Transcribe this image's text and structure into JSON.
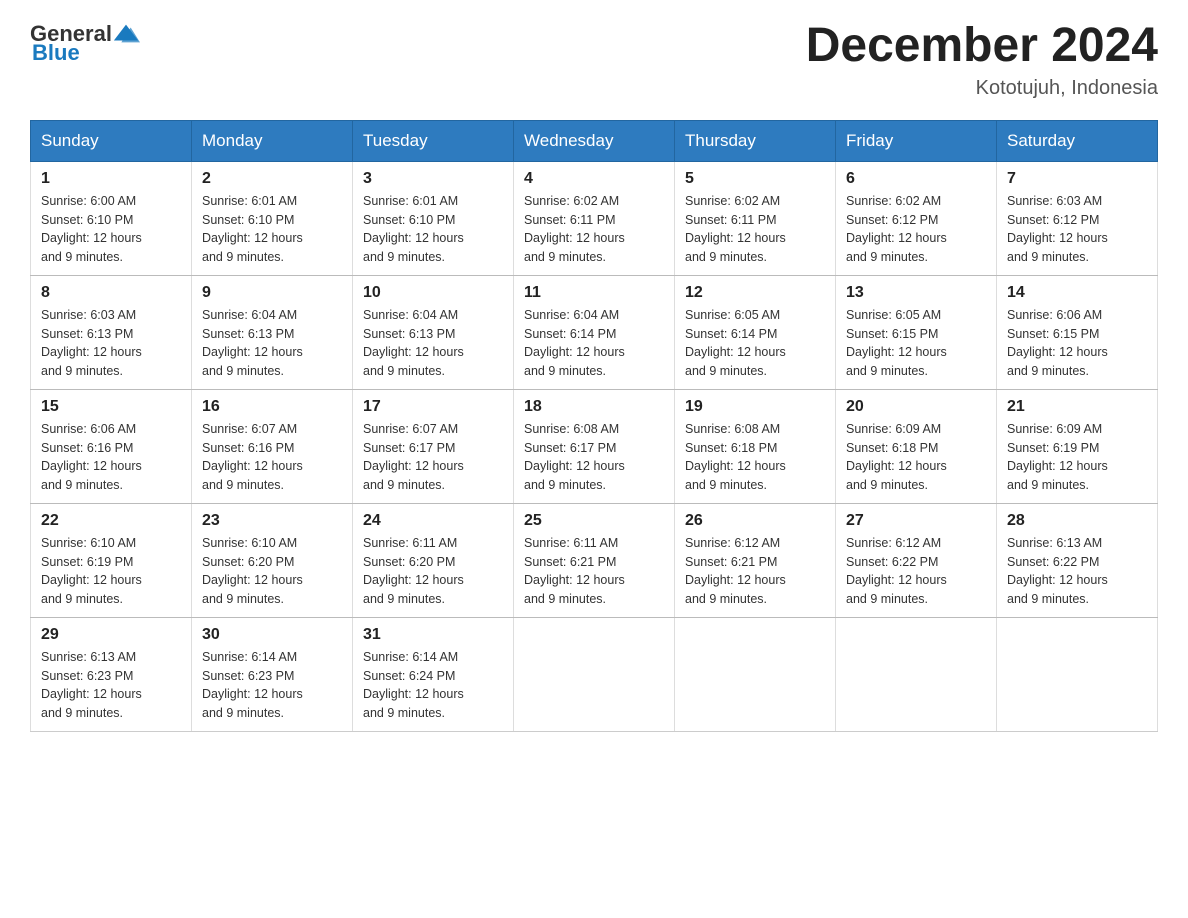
{
  "header": {
    "logo": {
      "general": "General",
      "blue": "Blue"
    },
    "title": "December 2024",
    "location": "Kototujuh, Indonesia"
  },
  "days_of_week": [
    "Sunday",
    "Monday",
    "Tuesday",
    "Wednesday",
    "Thursday",
    "Friday",
    "Saturday"
  ],
  "weeks": [
    [
      {
        "day": "1",
        "sunrise": "6:00 AM",
        "sunset": "6:10 PM",
        "daylight": "12 hours and 9 minutes."
      },
      {
        "day": "2",
        "sunrise": "6:01 AM",
        "sunset": "6:10 PM",
        "daylight": "12 hours and 9 minutes."
      },
      {
        "day": "3",
        "sunrise": "6:01 AM",
        "sunset": "6:10 PM",
        "daylight": "12 hours and 9 minutes."
      },
      {
        "day": "4",
        "sunrise": "6:02 AM",
        "sunset": "6:11 PM",
        "daylight": "12 hours and 9 minutes."
      },
      {
        "day": "5",
        "sunrise": "6:02 AM",
        "sunset": "6:11 PM",
        "daylight": "12 hours and 9 minutes."
      },
      {
        "day": "6",
        "sunrise": "6:02 AM",
        "sunset": "6:12 PM",
        "daylight": "12 hours and 9 minutes."
      },
      {
        "day": "7",
        "sunrise": "6:03 AM",
        "sunset": "6:12 PM",
        "daylight": "12 hours and 9 minutes."
      }
    ],
    [
      {
        "day": "8",
        "sunrise": "6:03 AM",
        "sunset": "6:13 PM",
        "daylight": "12 hours and 9 minutes."
      },
      {
        "day": "9",
        "sunrise": "6:04 AM",
        "sunset": "6:13 PM",
        "daylight": "12 hours and 9 minutes."
      },
      {
        "day": "10",
        "sunrise": "6:04 AM",
        "sunset": "6:13 PM",
        "daylight": "12 hours and 9 minutes."
      },
      {
        "day": "11",
        "sunrise": "6:04 AM",
        "sunset": "6:14 PM",
        "daylight": "12 hours and 9 minutes."
      },
      {
        "day": "12",
        "sunrise": "6:05 AM",
        "sunset": "6:14 PM",
        "daylight": "12 hours and 9 minutes."
      },
      {
        "day": "13",
        "sunrise": "6:05 AM",
        "sunset": "6:15 PM",
        "daylight": "12 hours and 9 minutes."
      },
      {
        "day": "14",
        "sunrise": "6:06 AM",
        "sunset": "6:15 PM",
        "daylight": "12 hours and 9 minutes."
      }
    ],
    [
      {
        "day": "15",
        "sunrise": "6:06 AM",
        "sunset": "6:16 PM",
        "daylight": "12 hours and 9 minutes."
      },
      {
        "day": "16",
        "sunrise": "6:07 AM",
        "sunset": "6:16 PM",
        "daylight": "12 hours and 9 minutes."
      },
      {
        "day": "17",
        "sunrise": "6:07 AM",
        "sunset": "6:17 PM",
        "daylight": "12 hours and 9 minutes."
      },
      {
        "day": "18",
        "sunrise": "6:08 AM",
        "sunset": "6:17 PM",
        "daylight": "12 hours and 9 minutes."
      },
      {
        "day": "19",
        "sunrise": "6:08 AM",
        "sunset": "6:18 PM",
        "daylight": "12 hours and 9 minutes."
      },
      {
        "day": "20",
        "sunrise": "6:09 AM",
        "sunset": "6:18 PM",
        "daylight": "12 hours and 9 minutes."
      },
      {
        "day": "21",
        "sunrise": "6:09 AM",
        "sunset": "6:19 PM",
        "daylight": "12 hours and 9 minutes."
      }
    ],
    [
      {
        "day": "22",
        "sunrise": "6:10 AM",
        "sunset": "6:19 PM",
        "daylight": "12 hours and 9 minutes."
      },
      {
        "day": "23",
        "sunrise": "6:10 AM",
        "sunset": "6:20 PM",
        "daylight": "12 hours and 9 minutes."
      },
      {
        "day": "24",
        "sunrise": "6:11 AM",
        "sunset": "6:20 PM",
        "daylight": "12 hours and 9 minutes."
      },
      {
        "day": "25",
        "sunrise": "6:11 AM",
        "sunset": "6:21 PM",
        "daylight": "12 hours and 9 minutes."
      },
      {
        "day": "26",
        "sunrise": "6:12 AM",
        "sunset": "6:21 PM",
        "daylight": "12 hours and 9 minutes."
      },
      {
        "day": "27",
        "sunrise": "6:12 AM",
        "sunset": "6:22 PM",
        "daylight": "12 hours and 9 minutes."
      },
      {
        "day": "28",
        "sunrise": "6:13 AM",
        "sunset": "6:22 PM",
        "daylight": "12 hours and 9 minutes."
      }
    ],
    [
      {
        "day": "29",
        "sunrise": "6:13 AM",
        "sunset": "6:23 PM",
        "daylight": "12 hours and 9 minutes."
      },
      {
        "day": "30",
        "sunrise": "6:14 AM",
        "sunset": "6:23 PM",
        "daylight": "12 hours and 9 minutes."
      },
      {
        "day": "31",
        "sunrise": "6:14 AM",
        "sunset": "6:24 PM",
        "daylight": "12 hours and 9 minutes."
      },
      null,
      null,
      null,
      null
    ]
  ],
  "labels": {
    "sunrise": "Sunrise:",
    "sunset": "Sunset:",
    "daylight": "Daylight:"
  }
}
